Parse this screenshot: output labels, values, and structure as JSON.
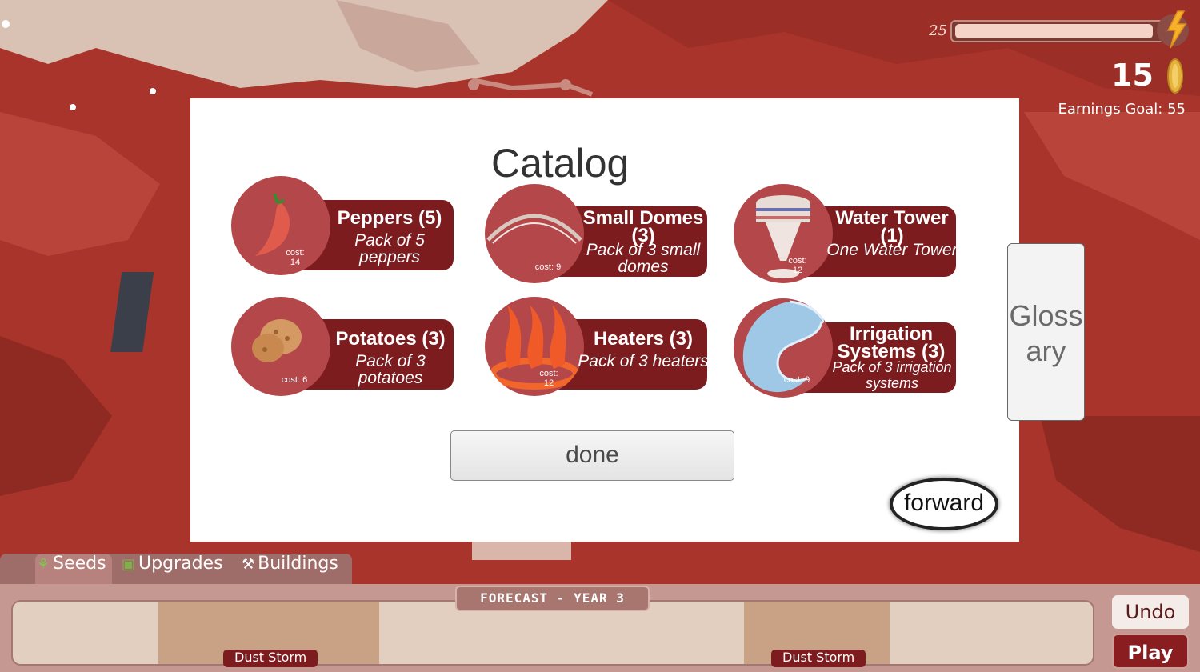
{
  "hud": {
    "energy_value": "25",
    "energy_level_fraction": 0.92,
    "coins": "15",
    "earnings_goal": "Earnings Goal: 55"
  },
  "catalog": {
    "title": "Catalog",
    "items": [
      {
        "name": "Peppers (5)",
        "desc": "Pack of 5 peppers",
        "cost": "cost:\n14",
        "icon": "pepper-icon"
      },
      {
        "name": "Small Domes (3)",
        "desc": "Pack of 3 small domes",
        "cost": "cost: 9",
        "icon": "dome-icon"
      },
      {
        "name": "Water Tower (1)",
        "desc": "One Water Tower",
        "cost": "cost:\n12",
        "icon": "water-tower-icon"
      },
      {
        "name": "Potatoes (3)",
        "desc": "Pack of 3 potatoes",
        "cost": "cost: 6",
        "icon": "potato-icon"
      },
      {
        "name": "Heaters (3)",
        "desc": "Pack of 3 heaters",
        "cost": "cost:\n12",
        "icon": "heater-icon"
      },
      {
        "name": "Irrigation Systems (3)",
        "desc": "Pack of 3 irrigation systems",
        "cost": "cost: 9",
        "icon": "irrigation-icon"
      }
    ],
    "done_label": "done",
    "forward_label": "forward"
  },
  "glossary_label": "Gloss ary",
  "tabs": [
    {
      "label": "Seeds",
      "icon": "sprout-icon"
    },
    {
      "label": "Upgrades",
      "icon": "upgrade-box-icon"
    },
    {
      "label": "Buildings",
      "icon": "hammer-pick-icon"
    }
  ],
  "forecast": {
    "title": "FORECAST - YEAR 3",
    "events": [
      "Dust Storm",
      "Dust Storm"
    ]
  },
  "controls": {
    "undo_label": "Undo",
    "play_label": "Play"
  },
  "colors": {
    "accent_dark_red": "#7c1c1f",
    "mars_red": "#a8332a",
    "circle_red": "#b3474a"
  }
}
